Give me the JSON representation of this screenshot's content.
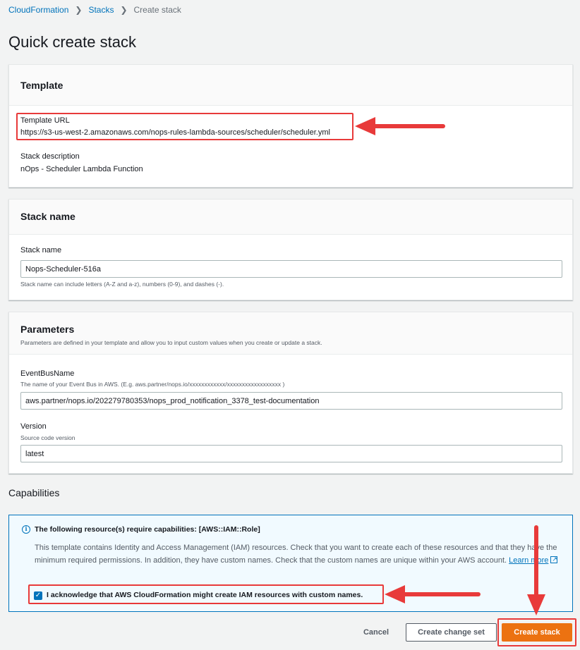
{
  "breadcrumb": {
    "items": [
      "CloudFormation",
      "Stacks"
    ],
    "current": "Create stack"
  },
  "page_title": "Quick create stack",
  "template_panel": {
    "title": "Template",
    "url_label": "Template URL",
    "url_value": "https://s3-us-west-2.amazonaws.com/nops-rules-lambda-sources/scheduler/scheduler.yml",
    "desc_label": "Stack description",
    "desc_value": "nOps - Scheduler Lambda Function"
  },
  "stack_name_panel": {
    "title": "Stack name",
    "label": "Stack name",
    "value": "Nops-Scheduler-516a",
    "hint": "Stack name can include letters (A-Z and a-z), numbers (0-9), and dashes (-)."
  },
  "parameters_panel": {
    "title": "Parameters",
    "subtitle": "Parameters are defined in your template and allow you to input custom values when you create or update a stack.",
    "event_bus": {
      "label": "EventBusName",
      "hint": "The name of your Event Bus in AWS. (E.g. aws.partner/nops.io/xxxxxxxxxxxx/xxxxxxxxxxxxxxxxxx )",
      "value": "aws.partner/nops.io/202279780353/nops_prod_notification_3378_test-documentation"
    },
    "version": {
      "label": "Version",
      "hint": "Source code version",
      "value": "latest"
    }
  },
  "capabilities": {
    "title": "Capabilities",
    "heading": "The following resource(s) require capabilities: [AWS::IAM::Role]",
    "text": "This template contains Identity and Access Management (IAM) resources. Check that you want to create each of these resources and that they have the minimum required permissions. In addition, they have custom names. Check that the custom names are unique within your AWS account.",
    "learn_more": "Learn more",
    "acknowledge_label": "I acknowledge that AWS CloudFormation might create IAM resources with custom names.",
    "acknowledge_checked": true
  },
  "actions": {
    "cancel": "Cancel",
    "create_change_set": "Create change set",
    "create_stack": "Create stack"
  },
  "colors": {
    "primary_button": "#ec7211",
    "link": "#0073bb",
    "annotation": "#e83a3a"
  }
}
